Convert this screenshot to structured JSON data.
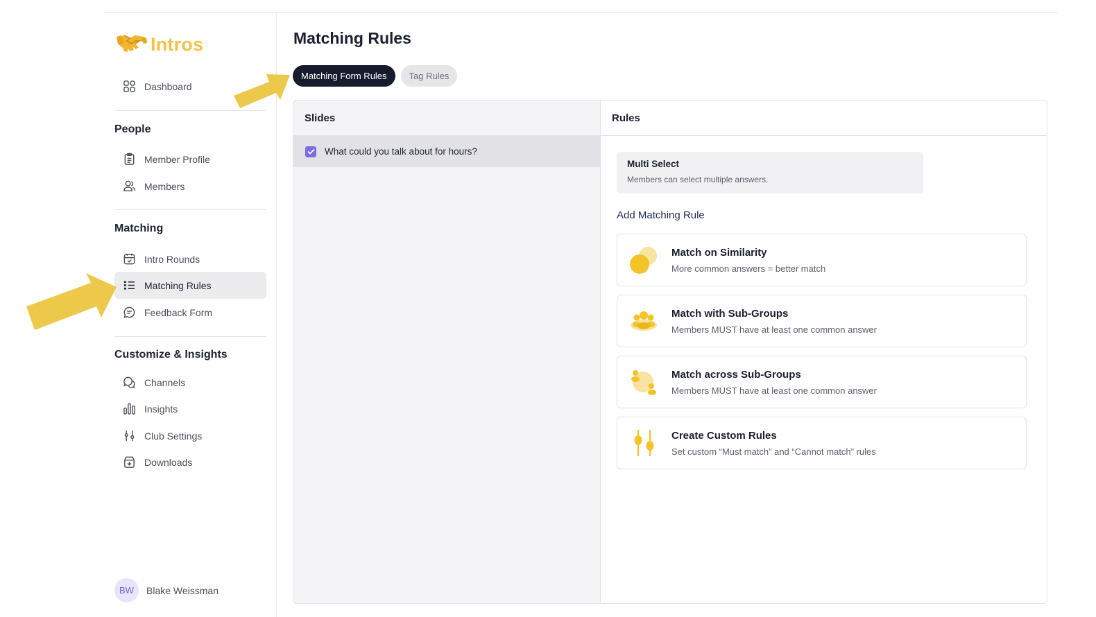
{
  "app": {
    "name": "Intros"
  },
  "sidebar": {
    "dashboard": {
      "label": "Dashboard",
      "icon": "grid-icon"
    },
    "sections": [
      {
        "title": "People",
        "items": [
          {
            "label": "Member Profile",
            "icon": "clipboard-icon"
          },
          {
            "label": "Members",
            "icon": "users-icon"
          }
        ]
      },
      {
        "title": "Matching",
        "items": [
          {
            "label": "Intro Rounds",
            "icon": "calendar-icon"
          },
          {
            "label": "Matching Rules",
            "icon": "list-icon",
            "active": true
          },
          {
            "label": "Feedback Form",
            "icon": "message-icon"
          }
        ]
      },
      {
        "title": "Customize & Insights",
        "items": [
          {
            "label": "Channels",
            "icon": "chat-icon"
          },
          {
            "label": "Insights",
            "icon": "bar-chart-icon"
          },
          {
            "label": "Club Settings",
            "icon": "sliders-icon"
          },
          {
            "label": "Downloads",
            "icon": "download-icon"
          }
        ]
      }
    ],
    "user": {
      "initials": "BW",
      "name": "Blake Weissman"
    }
  },
  "main": {
    "title": "Matching Rules",
    "tabs": [
      {
        "label": "Matching Form Rules",
        "active": true
      },
      {
        "label": "Tag Rules",
        "active": false
      }
    ],
    "slides": {
      "header": "Slides",
      "items": [
        {
          "label": "What could you talk about for hours?",
          "checked": true
        }
      ]
    },
    "rules": {
      "header": "Rules",
      "question_type": {
        "title": "Multi Select",
        "description": "Members can select multiple answers."
      },
      "add_title": "Add Matching Rule",
      "options": [
        {
          "title": "Match on Similarity",
          "description": "More common answers = better match",
          "icon": "overlap-circles-icon"
        },
        {
          "title": "Match with Sub-Groups",
          "description": "Members MUST have at least one common answer",
          "icon": "group-icon"
        },
        {
          "title": "Match across Sub-Groups",
          "description": "Members MUST have at least one common answer",
          "icon": "scatter-group-icon"
        },
        {
          "title": "Create Custom Rules",
          "description": "Set custom “Must match” and “Cannot match” rules",
          "icon": "custom-sliders-icon"
        }
      ]
    }
  },
  "colors": {
    "accent": "#f0c24a",
    "active_tab": "#161b2e",
    "checkbox": "#7b6ce0",
    "annotation_arrow": "#ecc94b"
  }
}
